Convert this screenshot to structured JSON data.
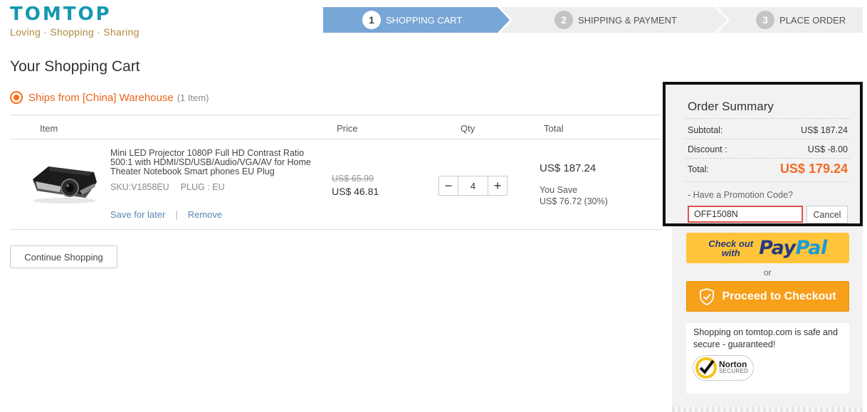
{
  "logo": {
    "brand": "TOMTOP",
    "tagline": "Loving · Shopping · Sharing"
  },
  "steps": [
    {
      "num": "1",
      "label": "SHOPPING CART"
    },
    {
      "num": "2",
      "label": "SHIPPING & PAYMENT"
    },
    {
      "num": "3",
      "label": "PLACE ORDER"
    }
  ],
  "cart": {
    "title": "Your Shopping Cart",
    "warehouse_label": "Ships from [China] Warehouse",
    "warehouse_count": "(1 Item)",
    "columns": {
      "item": "Item",
      "price": "Price",
      "qty": "Qty",
      "total": "Total"
    },
    "product": {
      "name": "Mini LED Projector 1080P Full HD Contrast Ratio 500:1 with HDMI/SD/USB/Audio/VGA/AV for Home Theater Notebook Smart phones EU Plug",
      "sku": "SKU:V1858EU",
      "plug": "PLUG : EU",
      "save_for_later": "Save for later",
      "separator": "|",
      "remove": "Remove",
      "price_old": "US$ 65.99",
      "price_new": "US$ 46.81",
      "qty": "4",
      "qty_minus": "−",
      "qty_plus": "+",
      "total": "US$ 187.24",
      "you_save_label": "You Save",
      "you_save_value": "US$ 76.72 (30%)"
    },
    "continue_label": "Continue Shopping"
  },
  "summary": {
    "title": "Order Summary",
    "subtotal_label": "Subtotal:",
    "subtotal_value": "US$ 187.24",
    "discount_label": "Discount :",
    "discount_value": "US$ -8.00",
    "total_label": "Total:",
    "total_value": "US$ 179.24",
    "promo_question": "- Have a Promotion Code?",
    "promo_code": "OFF1508N",
    "cancel_label": "Cancel"
  },
  "paypal": {
    "checkout_text_1": "Check out",
    "checkout_text_2": "with",
    "logo_pay": "Pay",
    "logo_pal": "Pal"
  },
  "or_text": "or",
  "checkout_label": "Proceed to Checkout",
  "secure": {
    "text": "Shopping on tomtop.com is safe and secure - guaranteed!",
    "norton_name": "Norton",
    "norton_sub": "SECURED"
  },
  "colors": {
    "brand": "#1597b0",
    "accent_orange": "#f26b21",
    "step_active": "#78a6d6",
    "checkout_orange": "#f7a01a",
    "paypal_yellow": "#ffc439"
  }
}
